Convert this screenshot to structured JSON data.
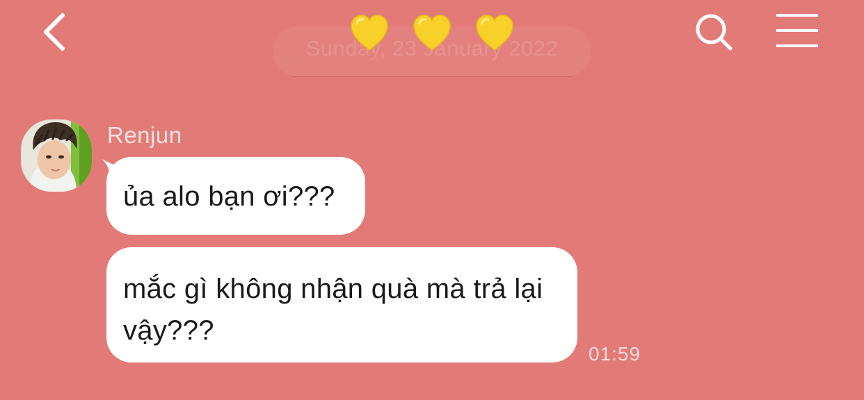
{
  "header": {
    "title_hearts": [
      "💛",
      "💛",
      "💛"
    ],
    "icons": {
      "back": "chevron-left-icon",
      "search": "search-icon",
      "menu": "hamburger-menu-icon"
    }
  },
  "date_header": "Sunday, 23 January 2022",
  "message_group": {
    "sender": "Renjun",
    "avatar": "renjun-avatar",
    "messages": [
      {
        "text": "ủa alo bạn ơi???"
      },
      {
        "text": "mắc gì không nhận quà mà trả lại vậy???"
      }
    ],
    "time": "01:59"
  },
  "colors": {
    "background": "#e27b78",
    "bubble": "#ffffff",
    "heart": "#f5cc1e"
  }
}
